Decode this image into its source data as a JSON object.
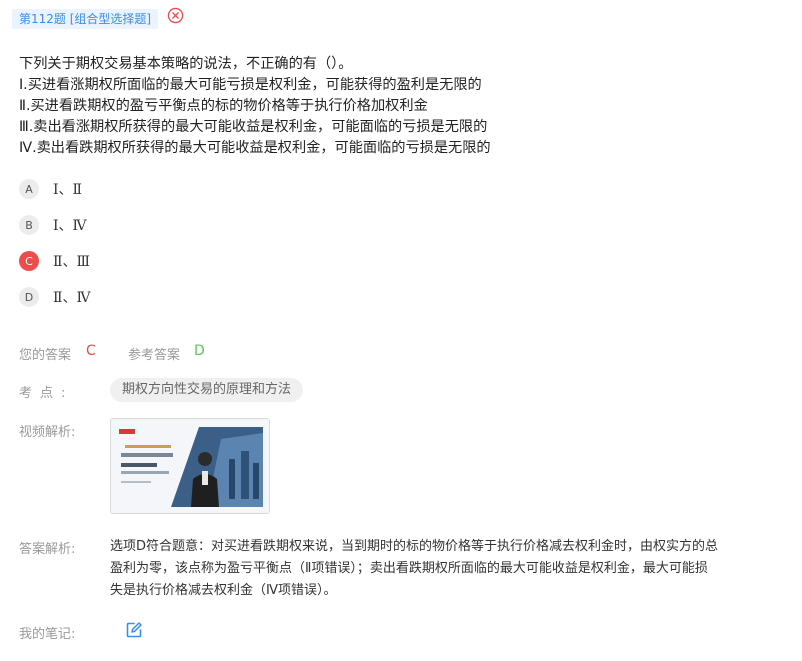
{
  "header": {
    "tag": "第112题 [组合型选择题]"
  },
  "question": {
    "stem": "下列关于期权交易基本策略的说法，不正确的有（）。",
    "statements": [
      "Ⅰ.买进看涨期权所面临的最大可能亏损是权利金，可能获得的盈利是无限的",
      "Ⅱ.买进看跌期权的盈亏平衡点的标的物价格等于执行价格加权利金",
      "Ⅲ.卖出看涨期权所获得的最大可能收益是权利金，可能面临的亏损是无限的",
      "Ⅳ.卖出看跌期权所获得的最大可能收益是权利金，可能面临的亏损是无限的"
    ]
  },
  "options": [
    {
      "key": "A",
      "text": "Ⅰ、Ⅱ"
    },
    {
      "key": "B",
      "text": "Ⅰ、Ⅳ"
    },
    {
      "key": "C",
      "text": "Ⅱ、Ⅲ"
    },
    {
      "key": "D",
      "text": "Ⅱ、Ⅳ"
    }
  ],
  "answer": {
    "your_label": "您的答案",
    "your_value": "C",
    "ref_label": "参考答案",
    "ref_value": "D"
  },
  "point": {
    "label": "考点:",
    "value": "期权方向性交易的原理和方法"
  },
  "video": {
    "label": "视频解析:"
  },
  "analysis": {
    "label": "答案解析:",
    "lines": [
      "选项D符合题意：对买进看跌期权来说，当到期时的标的物价格等于执行价格减去权利金时，由权实方的总",
      "盈利为零，该点称为盈亏平衡点（Ⅱ项错误）；卖出看跌期权所面临的最大可能收益是权利金，最大可能损",
      "失是执行价格减去权利金（Ⅳ项错误）。"
    ]
  },
  "notes": {
    "label": "我的笔记:"
  },
  "colors": {
    "wrong": "#ee4b4b",
    "correct": "#5cc55c",
    "accent": "#3a8ee6"
  },
  "icons": {
    "close": "close-circle-icon",
    "edit": "edit-icon",
    "video": "video-thumbnail"
  }
}
